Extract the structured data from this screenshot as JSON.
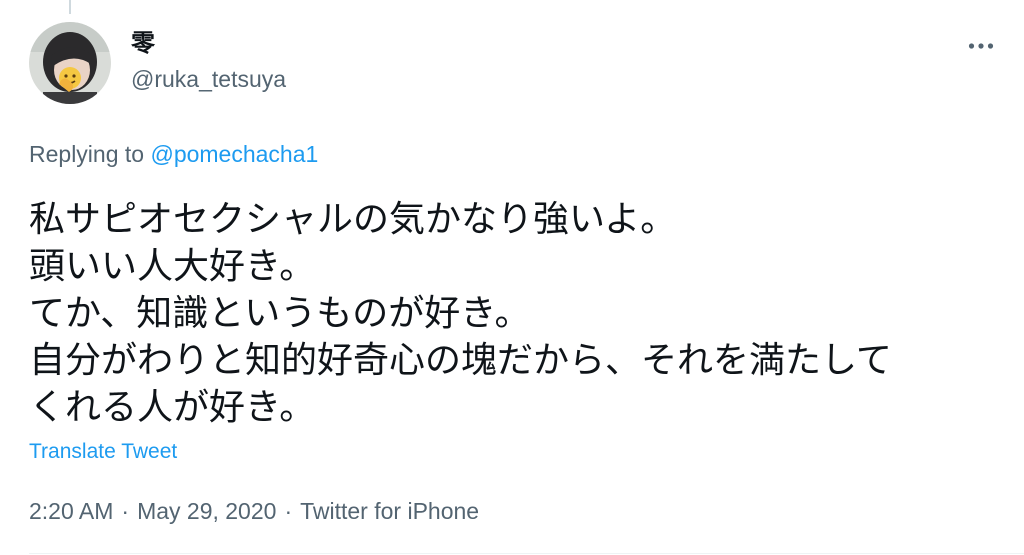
{
  "tweet": {
    "author": {
      "display_name": "零",
      "handle": "@ruka_tetsuya",
      "avatar_icon": "avatar-photo-icon"
    },
    "more_icon": "more-horizontal-icon",
    "replying_prefix": "Replying to ",
    "replying_mention": "@pomechacha1",
    "text_lines": [
      "私サピオセクシャルの気かなり強いよ。",
      "頭いい人大好き。",
      "てか、知識というものが好き。",
      "自分がわりと知的好奇心の塊だから、それを満たして",
      "くれる人が好き。"
    ],
    "translate_label": "Translate Tweet",
    "time": "2:20 AM",
    "date": "May 29, 2020",
    "source": "Twitter for iPhone",
    "separator": "·"
  },
  "colors": {
    "text_primary": "#0f1419",
    "text_secondary": "#536471",
    "link": "#1d9bf0"
  }
}
